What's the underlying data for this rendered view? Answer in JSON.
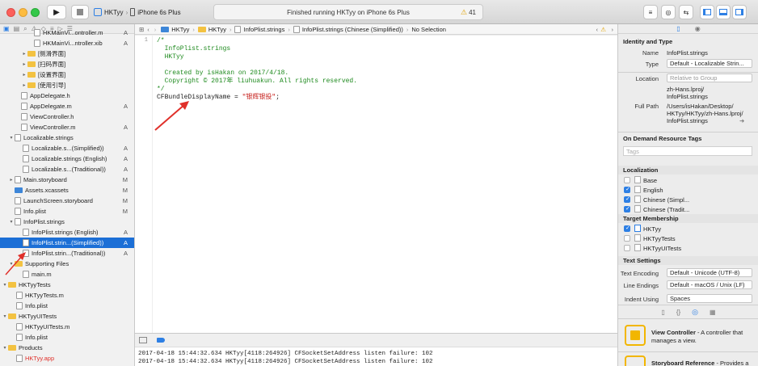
{
  "toolbar": {
    "scheme": "HKTyy",
    "device": "iPhone 6s Plus",
    "activity_text": "Finished running HKTyy on iPhone 6s Plus",
    "warning_count": "41"
  },
  "navigator": {
    "rows": [
      {
        "label": "HKMainVi...ontroller.m",
        "status": "A"
      },
      {
        "label": "HKMainVi...ntroller.xib",
        "status": "A"
      },
      {
        "label": "[侧滑界面]",
        "status": ""
      },
      {
        "label": "[扫码界面]",
        "status": ""
      },
      {
        "label": "[设置界面]",
        "status": ""
      },
      {
        "label": "[使用引导]",
        "status": ""
      },
      {
        "label": "AppDelegate.h",
        "status": ""
      },
      {
        "label": "AppDelegate.m",
        "status": "A"
      },
      {
        "label": "ViewController.h",
        "status": ""
      },
      {
        "label": "ViewController.m",
        "status": "A"
      },
      {
        "label": "Localizable.strings",
        "status": ""
      },
      {
        "label": "Localizable.s...(Simplified))",
        "status": "A"
      },
      {
        "label": "Localizable.strings (English)",
        "status": "A"
      },
      {
        "label": "Localizable.s...(Traditional))",
        "status": "A"
      },
      {
        "label": "Main.storyboard",
        "status": "M"
      },
      {
        "label": "Assets.xcassets",
        "status": "M"
      },
      {
        "label": "LaunchScreen.storyboard",
        "status": "M"
      },
      {
        "label": "Info.plist",
        "status": "M"
      },
      {
        "label": "InfoPlist.strings",
        "status": ""
      },
      {
        "label": "InfoPlist.strings (English)",
        "status": "A"
      },
      {
        "label": "InfoPlist.strin...(Simplified))",
        "status": "A"
      },
      {
        "label": "InfoPlist.strin...(Traditional))",
        "status": "A"
      },
      {
        "label": "Supporting Files",
        "status": ""
      },
      {
        "label": "main.m",
        "status": ""
      },
      {
        "label": "HKTyyTests",
        "status": ""
      },
      {
        "label": "HKTyyTests.m",
        "status": ""
      },
      {
        "label": "Info.plist",
        "status": ""
      },
      {
        "label": "HKTyyUITests",
        "status": ""
      },
      {
        "label": "HKTyyUITests.m",
        "status": ""
      },
      {
        "label": "Info.plist",
        "status": ""
      },
      {
        "label": "Products",
        "status": ""
      },
      {
        "label": "HKTyy.app",
        "status": ""
      }
    ]
  },
  "jumpbar": {
    "items": [
      "HKTyy",
      "HKTyy",
      "InfoPlist.strings",
      "InfoPlist.strings (Chinese (Simplified))",
      "No Selection"
    ]
  },
  "editor": {
    "line_number": "1",
    "lines": [
      "/*",
      "  InfoPlist.strings",
      "  HKTyy",
      "",
      "  Created by isHakan on 2017/4/18.",
      "  Copyright © 2017年 liuhuakun. All rights reserved.",
      "*/"
    ],
    "code_key": "CFBundleDisplayName = ",
    "code_value": "\"银辉银投\"",
    "code_end": ";"
  },
  "console": {
    "lines": [
      "2017-04-18 15:44:32.634 HKTyy[4118:264926] CFSocketSetAddress listen failure: 102",
      "2017-04-18 15:44:32.634 HKTyy[4118:264926] CFSocketSetAddress listen failure: 102"
    ]
  },
  "inspector": {
    "identity_header": "Identity and Type",
    "name_label": "Name",
    "name_value": "InfoPlist.strings",
    "type_label": "Type",
    "type_value": "Default - Localizable Strin...",
    "location_label": "Location",
    "location_value": "Relative to Group",
    "location_path_1": "zh-Hans.lproj/",
    "location_path_2": "InfoPlist.strings",
    "fullpath_label": "Full Path",
    "fullpath_1": "/Users/isHakan/Desktop/",
    "fullpath_2": "HKTyy/HKTyy/zh-Hans.lproj/",
    "fullpath_3": "InfoPlist.strings",
    "odr_header": "On Demand Resource Tags",
    "tags_placeholder": "Tags",
    "localization_header": "Localization",
    "localizations": [
      {
        "label": "Base",
        "checked": false
      },
      {
        "label": "English",
        "checked": true
      },
      {
        "label": "Chinese (Simpl...",
        "checked": true
      },
      {
        "label": "Chinese (Tradit...",
        "checked": true
      }
    ],
    "target_header": "Target Membership",
    "targets": [
      {
        "label": "HKTyy",
        "checked": true
      },
      {
        "label": "HKTyyTests",
        "checked": false
      },
      {
        "label": "HKTyyUITests",
        "checked": false
      }
    ],
    "text_settings_header": "Text Settings",
    "encoding_label": "Text Encoding",
    "encoding_value": "Default - Unicode (UTF-8)",
    "line_endings_label": "Line Endings",
    "line_endings_value": "Default - macOS / Unix (LF)",
    "indent_label": "Indent Using",
    "indent_value": "Spaces",
    "library": [
      {
        "title": "View Controller",
        "desc": " - A controller that manages a view."
      },
      {
        "title": "Storyboard Reference",
        "desc": " - Provides a"
      }
    ]
  },
  "colors": {
    "selection": "#1c6fd6",
    "comment": "#1e8a1e",
    "string": "#c41a16",
    "annotation_arrow": "#e0302a"
  }
}
